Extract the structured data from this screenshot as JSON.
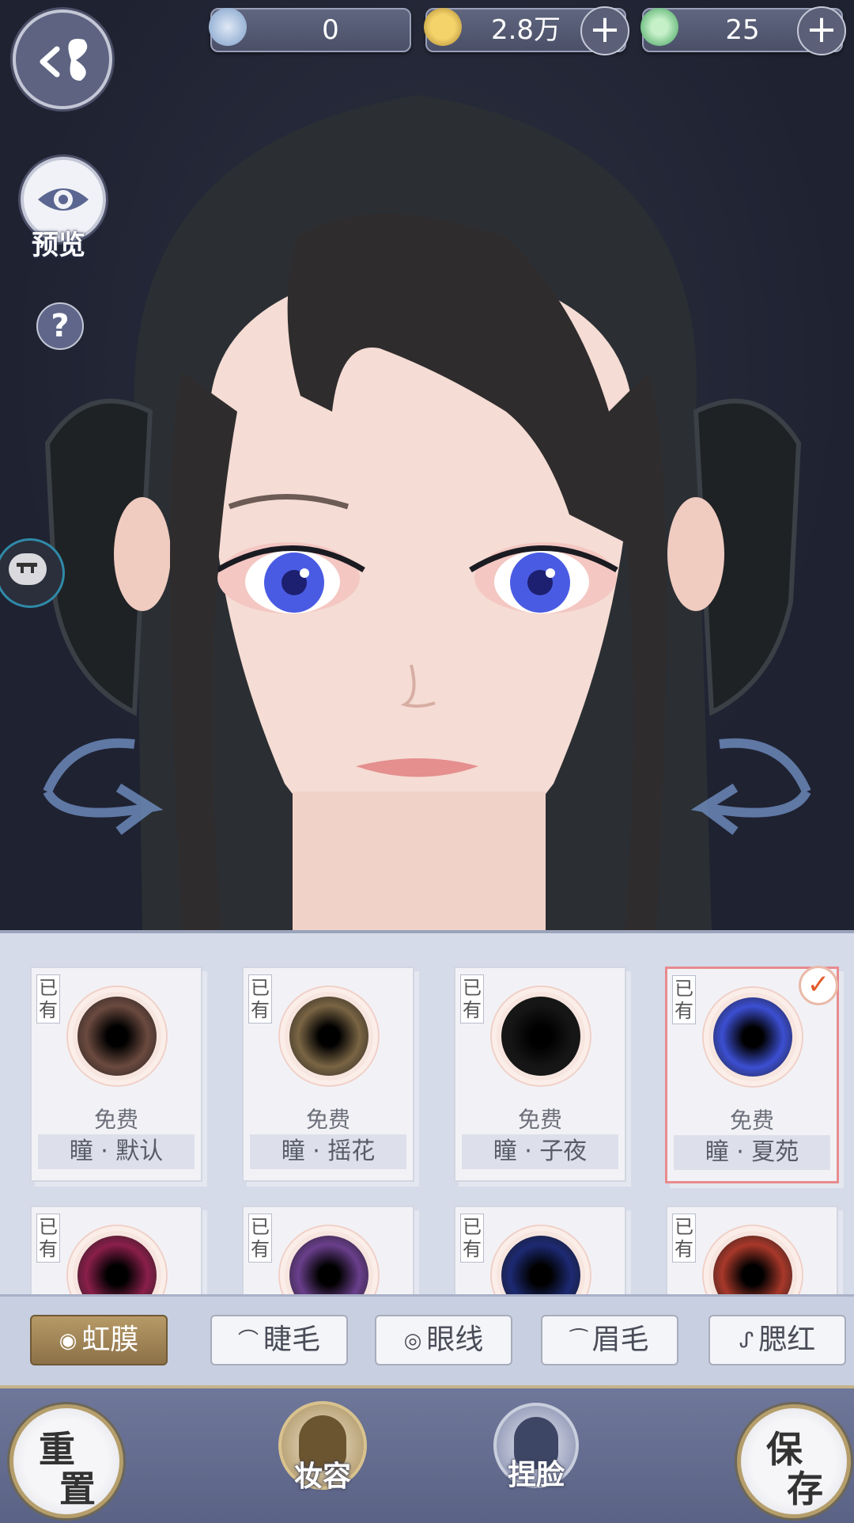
{
  "currency": {
    "jade": {
      "value": "0",
      "icon": "jade-coin-icon"
    },
    "coins": {
      "value": "2.8万",
      "icon": "gold-coin-icon"
    },
    "tokens": {
      "value": "25",
      "icon": "green-token-icon"
    }
  },
  "side": {
    "preview_label": "预览",
    "help_label": "?"
  },
  "items": [
    {
      "tag": "已有",
      "price": "免费",
      "name": "瞳 · 默认",
      "color": "#6b4a3f"
    },
    {
      "tag": "已有",
      "price": "免费",
      "name": "瞳 · 摇花",
      "color": "#7a6544"
    },
    {
      "tag": "已有",
      "price": "免费",
      "name": "瞳 · 子夜",
      "color": "#151515"
    },
    {
      "tag": "已有",
      "price": "免费",
      "name": "瞳 · 夏苑",
      "color": "#3c4fd2",
      "selected": true
    },
    {
      "tag": "已有",
      "color": "#8a1f4a"
    },
    {
      "tag": "已有",
      "color": "#6a3f8c"
    },
    {
      "tag": "已有",
      "color": "#1d2a73"
    },
    {
      "tag": "已有",
      "color": "#a8382a"
    }
  ],
  "tabs": [
    {
      "label": "虹膜",
      "icon": "◉",
      "active": true
    },
    {
      "label": "睫毛",
      "icon": "⌒"
    },
    {
      "label": "眼线",
      "icon": "◎"
    },
    {
      "label": "眉毛",
      "icon": "⁀"
    },
    {
      "label": "腮红",
      "icon": "ᔑ"
    }
  ],
  "bottom": {
    "reset": [
      "重",
      "置"
    ],
    "makeup": "妆容",
    "face": "捏脸",
    "save": [
      "保",
      "存"
    ]
  },
  "colors": {
    "accent_gold": "#b69a67",
    "selected_border": "#e88b8f",
    "check": "#e25a2a"
  }
}
